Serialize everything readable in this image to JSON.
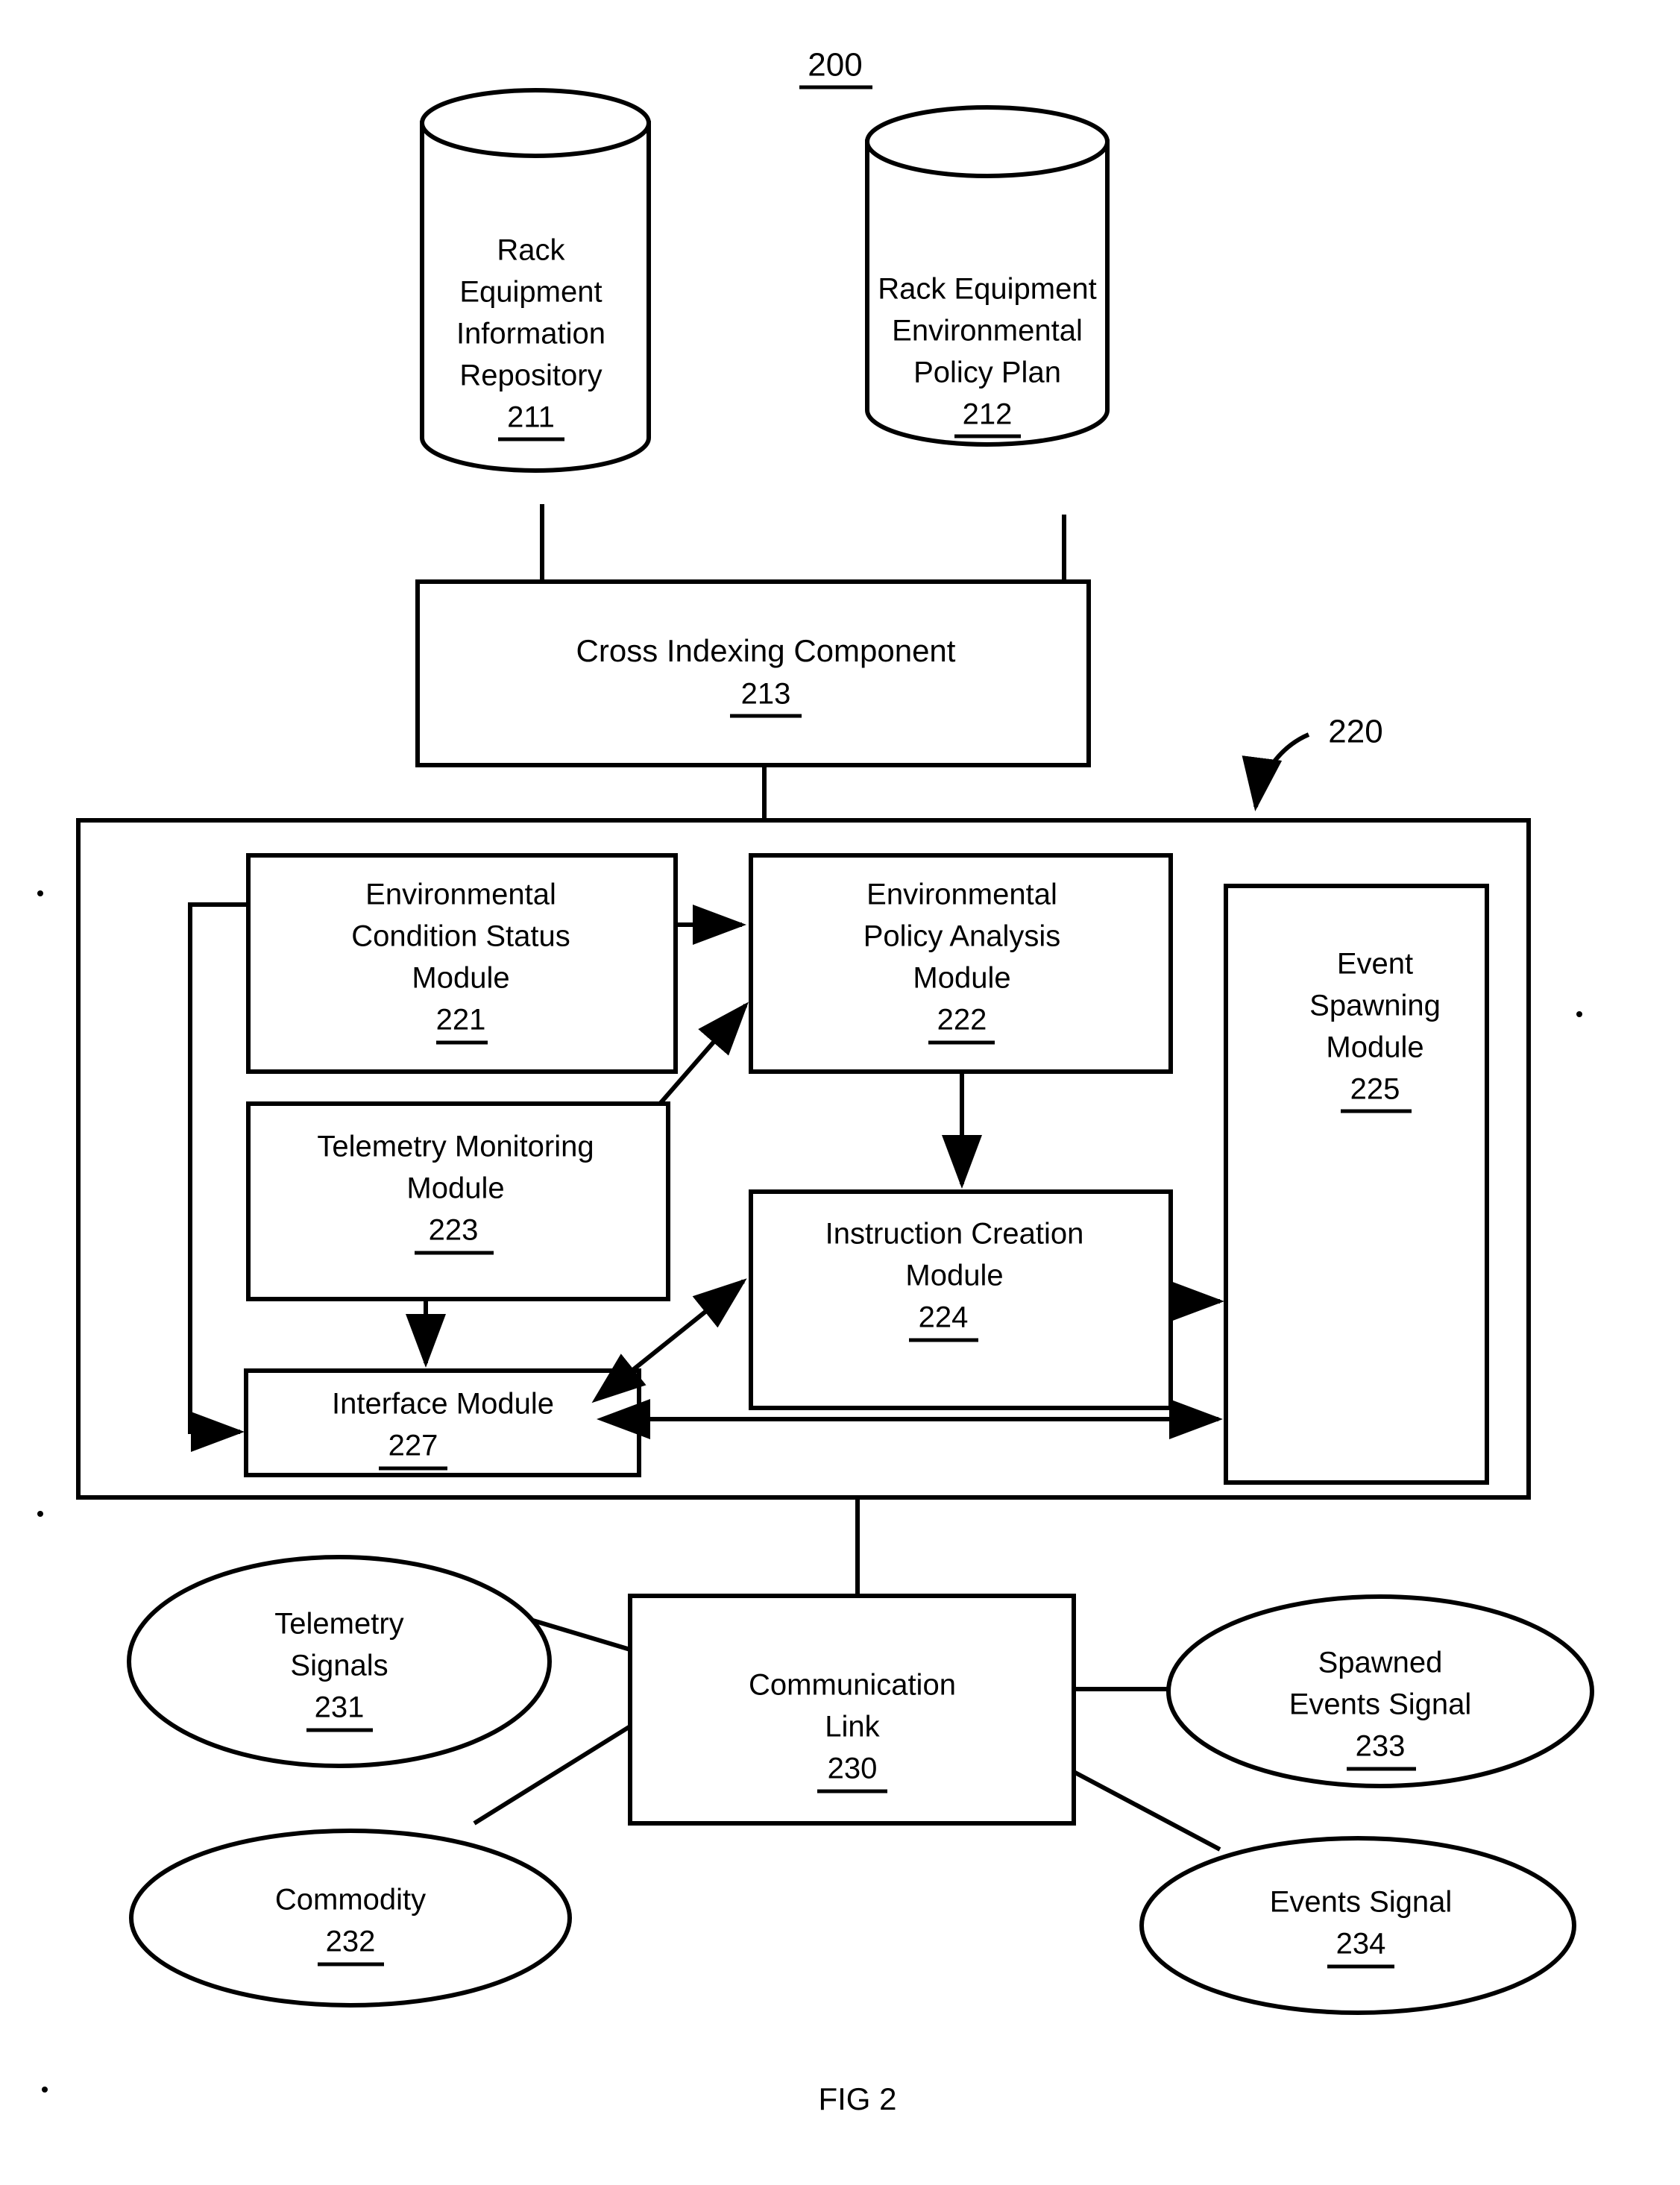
{
  "figure": {
    "number_label": "200",
    "caption": "FIG 2"
  },
  "nodes": {
    "repository_211": {
      "lines": [
        "Rack",
        "Equipment",
        "Information",
        "Repository"
      ],
      "ref": "211",
      "shape": "cylinder"
    },
    "policy_plan_212": {
      "lines": [
        "Rack Equipment",
        "Environmental",
        "Policy Plan"
      ],
      "ref": "212",
      "shape": "cylinder"
    },
    "cross_indexing_213": {
      "lines": [
        "Cross Indexing Component"
      ],
      "ref": "213",
      "shape": "rect"
    },
    "container_220": {
      "ref": "220",
      "shape": "rect"
    },
    "env_condition_status_221": {
      "lines": [
        "Environmental",
        "Condition Status",
        "Module"
      ],
      "ref": "221",
      "shape": "rect"
    },
    "env_policy_analysis_222": {
      "lines": [
        "Environmental",
        "Policy Analysis",
        "Module"
      ],
      "ref": "222",
      "shape": "rect"
    },
    "telemetry_monitoring_223": {
      "lines": [
        "Telemetry Monitoring",
        "Module"
      ],
      "ref": "223",
      "shape": "rect"
    },
    "instruction_creation_224": {
      "lines": [
        "Instruction Creation",
        "Module"
      ],
      "ref": "224",
      "shape": "rect"
    },
    "event_spawning_225": {
      "lines": [
        "Event",
        "Spawning",
        "Module"
      ],
      "ref": "225",
      "shape": "rect"
    },
    "interface_module_227": {
      "lines": [
        "Interface Module"
      ],
      "ref": "227",
      "shape": "rect"
    },
    "communication_link_230": {
      "lines": [
        "Communication",
        "Link"
      ],
      "ref": "230",
      "shape": "rect"
    },
    "telemetry_signals_231": {
      "lines": [
        "Telemetry",
        "Signals"
      ],
      "ref": "231",
      "shape": "ellipse"
    },
    "commodity_232": {
      "lines": [
        "Commodity"
      ],
      "ref": "232",
      "shape": "ellipse"
    },
    "spawned_events_signal_233": {
      "lines": [
        "Spawned",
        "Events Signal"
      ],
      "ref": "233",
      "shape": "ellipse"
    },
    "events_signal_234": {
      "lines": [
        "Events Signal"
      ],
      "ref": "234",
      "shape": "ellipse"
    }
  }
}
